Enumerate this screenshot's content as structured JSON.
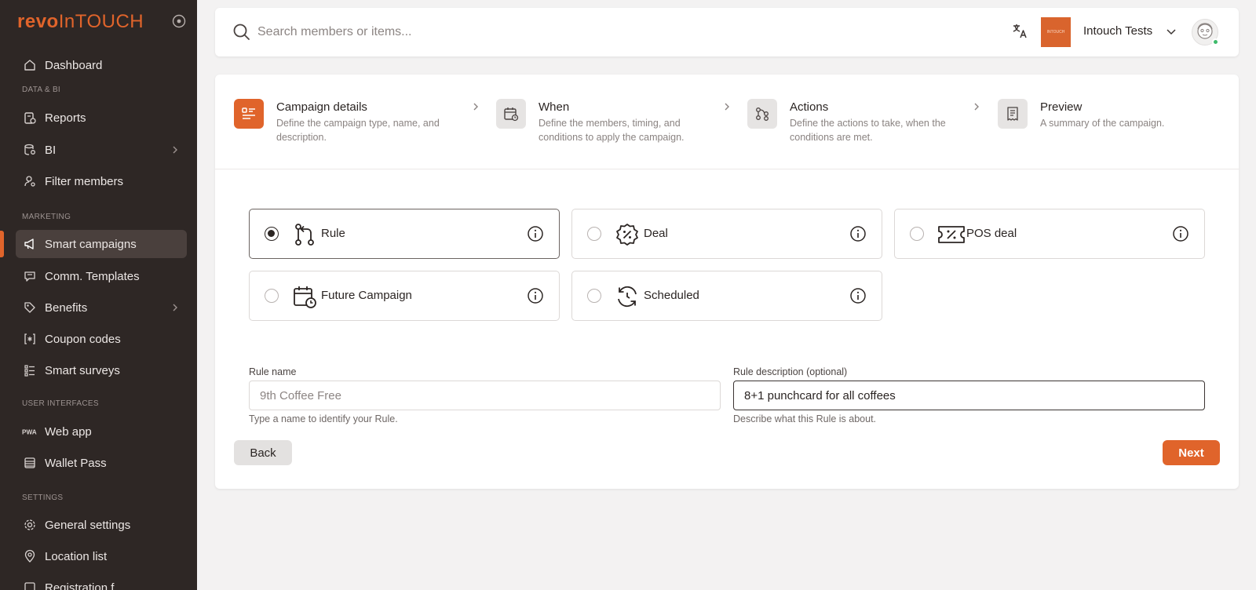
{
  "brand": {
    "logo_part1": "revo",
    "logo_part2": "InTOUCH",
    "accent": "#e0642b"
  },
  "sidebar": {
    "items": [
      {
        "label": "Dashboard",
        "icon": "home-icon"
      },
      {
        "label": "Reports",
        "icon": "reports-icon"
      },
      {
        "label": "BI",
        "icon": "database-search-icon",
        "has_submenu": true
      },
      {
        "label": "Filter members",
        "icon": "user-search-icon"
      },
      {
        "label": "Smart campaigns",
        "icon": "megaphone-icon",
        "active": true
      },
      {
        "label": "Comm. Templates",
        "icon": "message-icon"
      },
      {
        "label": "Benefits",
        "icon": "tag-icon",
        "has_submenu": true
      },
      {
        "label": "Coupon codes",
        "icon": "coupon-icon"
      },
      {
        "label": "Smart surveys",
        "icon": "list-check-icon"
      },
      {
        "label": "Web app",
        "icon": "pwa-icon"
      },
      {
        "label": "Wallet Pass",
        "icon": "wallet-icon"
      },
      {
        "label": "General settings",
        "icon": "gear-icon"
      },
      {
        "label": "Location list",
        "icon": "location-pin-icon"
      },
      {
        "label": "Registration f...",
        "icon": "form-icon"
      }
    ],
    "sections": [
      "DATA & BI",
      "MARKETING",
      "USER INTERFACES",
      "SETTINGS"
    ]
  },
  "topbar": {
    "search_placeholder": "Search members or items...",
    "org_logo_text": "INTOUCH",
    "org_name": "Intouch Tests"
  },
  "steps": [
    {
      "title": "Campaign details",
      "description": "Define the campaign type, name, and description.",
      "current": true
    },
    {
      "title": "When",
      "description": "Define the members, timing, and conditions to apply the campaign."
    },
    {
      "title": "Actions",
      "description": "Define the actions to take, when the conditions are met."
    },
    {
      "title": "Preview",
      "description": "A summary of the campaign."
    }
  ],
  "campaign_types": [
    {
      "label": "Rule",
      "icon": "git-branch-icon",
      "selected": true
    },
    {
      "label": "Deal",
      "icon": "discount-badge-icon",
      "selected": false
    },
    {
      "label": "POS deal",
      "icon": "ticket-percent-icon",
      "selected": false
    },
    {
      "label": "Future Campaign",
      "icon": "calendar-clock-icon",
      "selected": false
    },
    {
      "label": "Scheduled",
      "icon": "refresh-clock-icon",
      "selected": false
    }
  ],
  "form": {
    "name": {
      "label": "Rule name",
      "placeholder": "9th Coffee Free",
      "hint": "Type a name to identify your Rule."
    },
    "description": {
      "label": "Rule description (optional)",
      "value": "8+1 punchcard for all coffees",
      "hint": "Describe what this Rule is about."
    }
  },
  "buttons": {
    "back": "Back",
    "next": "Next"
  }
}
